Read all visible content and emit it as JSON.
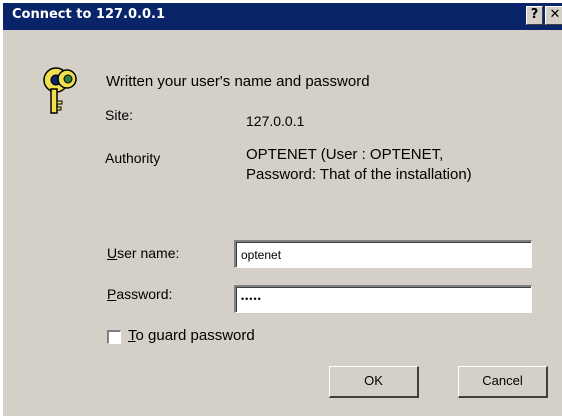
{
  "window": {
    "title": "Connect to 127.0.0.1",
    "help_button": "?",
    "close_button": "✕"
  },
  "message": "Written your user's name and password",
  "site": {
    "label": "Site:",
    "value": "127.0.0.1"
  },
  "authority": {
    "label": "Authority",
    "line1": "OPTENET (User   : OPTENET,",
    "line2": "Password: That of the installation)"
  },
  "form": {
    "username_label_underlined": "U",
    "username_label_rest": "ser name:",
    "username_value": "optenet",
    "password_label_underlined": "P",
    "password_label_rest": "assword:",
    "password_value": "•••••",
    "remember_label_underlined": "T",
    "remember_label_rest": "o guard password",
    "remember_checked": false
  },
  "buttons": {
    "ok": "OK",
    "cancel": "Cancel"
  },
  "icons": {
    "key": "key-icon"
  }
}
